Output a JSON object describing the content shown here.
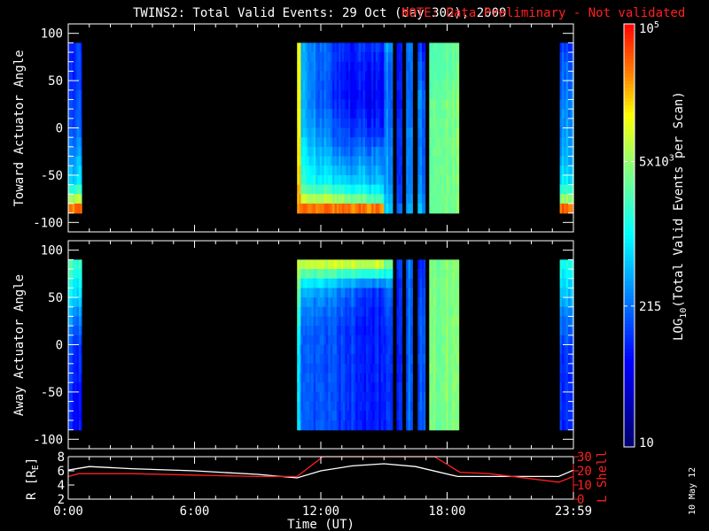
{
  "title": "TWINS2: Total Valid Events: 29 Oct (day 302), 2009",
  "note": "NOTE: Data Preliminary - Not validated",
  "footer_date": "10 May 12",
  "colors": {
    "note": "#ff2020",
    "lshell": "#ff2020",
    "r_line": "#ffffff"
  },
  "chart_data": [
    {
      "type": "heatmap",
      "name": "toward",
      "ylabel": "Toward Actuator Angle",
      "ylim": [
        -110,
        110
      ],
      "yticks": [
        "100",
        "50",
        "0",
        "-50",
        "-100"
      ],
      "ytick_values": [
        100,
        50,
        0,
        -50,
        -100
      ],
      "xlim_hours": [
        0,
        24
      ],
      "profile_angles": [
        85,
        60,
        30,
        0,
        -30,
        -60,
        -75,
        -85
      ],
      "value_units": "log10 events per scan",
      "segments": [
        {
          "t": [
            0,
            0.63
          ],
          "start": [
            2.0,
            2.0,
            2.1,
            2.2,
            2.5,
            2.9,
            3.8,
            4.6
          ]
        },
        {
          "t": [
            10.87,
            11.05
          ],
          "start": [
            4.2,
            4.2,
            4.2,
            4.2,
            4.3,
            4.4,
            4.5,
            4.6
          ]
        },
        {
          "t": [
            11.05,
            13.0
          ],
          "start": [
            2.6,
            2.6,
            2.6,
            2.7,
            3.0,
            3.2,
            3.9,
            4.6
          ],
          "end": [
            2.0,
            1.9,
            1.9,
            2.1,
            2.4,
            2.9,
            3.7,
            4.6
          ]
        },
        {
          "t": [
            13.0,
            15.0
          ],
          "start": [
            2.0,
            1.9,
            1.9,
            2.1,
            2.4,
            2.9,
            3.7,
            4.6
          ],
          "end": [
            2.0,
            1.8,
            1.7,
            1.9,
            2.4,
            2.7,
            3.2,
            4.5
          ]
        },
        {
          "t": [
            15.0,
            15.4
          ],
          "start": [
            2.5,
            2.3,
            2.3,
            2.4,
            2.5,
            2.5,
            2.7,
            2.8
          ]
        },
        {
          "t": [
            15.6,
            15.85
          ],
          "start": [
            1.9,
            1.9,
            1.9,
            2.0,
            2.0,
            2.0,
            2.1,
            2.3
          ]
        },
        {
          "t": [
            16.05,
            16.35
          ],
          "start": [
            2.5,
            2.4,
            2.4,
            2.5,
            2.5,
            2.5,
            2.6,
            2.7
          ]
        },
        {
          "t": [
            16.6,
            16.95
          ],
          "start": [
            2.0,
            2.2,
            2.4,
            2.3,
            2.3,
            2.4,
            2.5,
            2.6
          ]
        },
        {
          "t": [
            17.15,
            18.55
          ],
          "start": [
            3.5,
            3.5,
            3.6,
            3.6,
            3.6,
            3.6,
            3.6,
            3.6
          ]
        },
        {
          "t": [
            23.35,
            24
          ],
          "start": [
            2.1,
            2.3,
            2.4,
            2.5,
            2.6,
            3.0,
            3.7,
            4.6
          ]
        }
      ]
    },
    {
      "type": "heatmap",
      "name": "away",
      "ylabel": "Away Actuator Angle",
      "ylim": [
        -110,
        110
      ],
      "yticks": [
        "100",
        "50",
        "0",
        "-50",
        "-100"
      ],
      "ytick_values": [
        100,
        50,
        0,
        -50,
        -100
      ],
      "xlim_hours": [
        0,
        24
      ],
      "profile_angles": [
        85,
        60,
        30,
        0,
        -30,
        -60,
        -75,
        -85
      ],
      "value_units": "log10 events per scan",
      "segments": [
        {
          "t": [
            0,
            0.63
          ],
          "start": [
            3.3,
            3.0,
            2.5,
            2.1,
            2.0,
            1.9,
            1.9,
            1.9
          ]
        },
        {
          "t": [
            10.87,
            11.05
          ],
          "start": [
            3.9,
            3.6,
            3.2,
            3.0,
            2.9,
            2.9,
            2.9,
            2.9
          ]
        },
        {
          "t": [
            11.05,
            15.0
          ],
          "start": [
            3.9,
            2.8,
            2.4,
            2.3,
            2.3,
            2.3,
            2.3,
            2.3
          ],
          "end": [
            3.9,
            2.0,
            1.9,
            1.9,
            1.9,
            1.9,
            1.9,
            1.9
          ]
        },
        {
          "t": [
            15.0,
            15.4
          ],
          "start": [
            3.5,
            2.3,
            2.1,
            2.0,
            2.0,
            2.0,
            2.0,
            2.0
          ]
        },
        {
          "t": [
            15.6,
            15.85
          ],
          "start": [
            2.0,
            1.9,
            1.9,
            1.9,
            1.9,
            1.9,
            1.9,
            1.9
          ]
        },
        {
          "t": [
            16.05,
            16.35
          ],
          "start": [
            2.4,
            2.3,
            2.3,
            2.3,
            2.3,
            2.3,
            2.3,
            2.3
          ]
        },
        {
          "t": [
            16.6,
            16.95
          ],
          "start": [
            2.0,
            2.1,
            2.2,
            2.2,
            2.2,
            2.2,
            2.2,
            2.2
          ]
        },
        {
          "t": [
            17.15,
            18.55
          ],
          "start": [
            3.6,
            3.6,
            3.6,
            3.6,
            3.6,
            3.6,
            3.6,
            3.6
          ]
        },
        {
          "t": [
            23.35,
            24
          ],
          "start": [
            3.1,
            2.8,
            2.4,
            2.1,
            2.0,
            2.0,
            2.0,
            2.0
          ]
        }
      ]
    },
    {
      "type": "line",
      "name": "orbit",
      "xlabel": "Time (UT)",
      "xticks": [
        "0:00",
        "6:00",
        "12:00",
        "18:00",
        "23:59"
      ],
      "xtick_hours": [
        0,
        6,
        12,
        18,
        24
      ],
      "ylabel_left": "R [R",
      "ylabel_left_sub": "E",
      "ylabel_left_close": "]",
      "ylim_left": [
        2,
        8
      ],
      "yticks_left": [
        "2",
        "4",
        "6",
        "8"
      ],
      "ylabel_right": "L Shell",
      "ylim_right": [
        0,
        30
      ],
      "yticks_right": [
        "0",
        "10",
        "20",
        "30"
      ],
      "series": [
        {
          "name": "R",
          "axis": "left",
          "x": [
            0,
            1,
            3,
            6,
            9,
            10.87,
            12,
            13.5,
            15,
            16.5,
            18.5,
            21,
            23.3,
            24
          ],
          "y": [
            6.1,
            6.6,
            6.3,
            6.0,
            5.5,
            5.0,
            6.0,
            6.7,
            7.0,
            6.6,
            5.2,
            5.2,
            5.2,
            6.1
          ]
        },
        {
          "name": "L Shell",
          "axis": "right",
          "x": [
            0,
            0.5,
            3,
            6,
            9,
            10.87,
            12.1,
            17.4,
            18.6,
            20,
            23.3,
            24
          ],
          "y": [
            16,
            18,
            18,
            17,
            16,
            16,
            30,
            30,
            19,
            18,
            12,
            16
          ]
        }
      ]
    }
  ],
  "colorbar": {
    "label": "LOG",
    "label_sub": "10",
    "label_rest": "(Total Valid  Events  per Scan)",
    "range_log10": [
      1,
      5
    ],
    "ticks": [
      {
        "text": "10",
        "log": 1
      },
      {
        "text": "215",
        "log": 2.332
      },
      {
        "text": "5x10",
        "sup": "3",
        "log": 3.699
      },
      {
        "text": "10",
        "sup": "5",
        "log": 5
      }
    ]
  }
}
